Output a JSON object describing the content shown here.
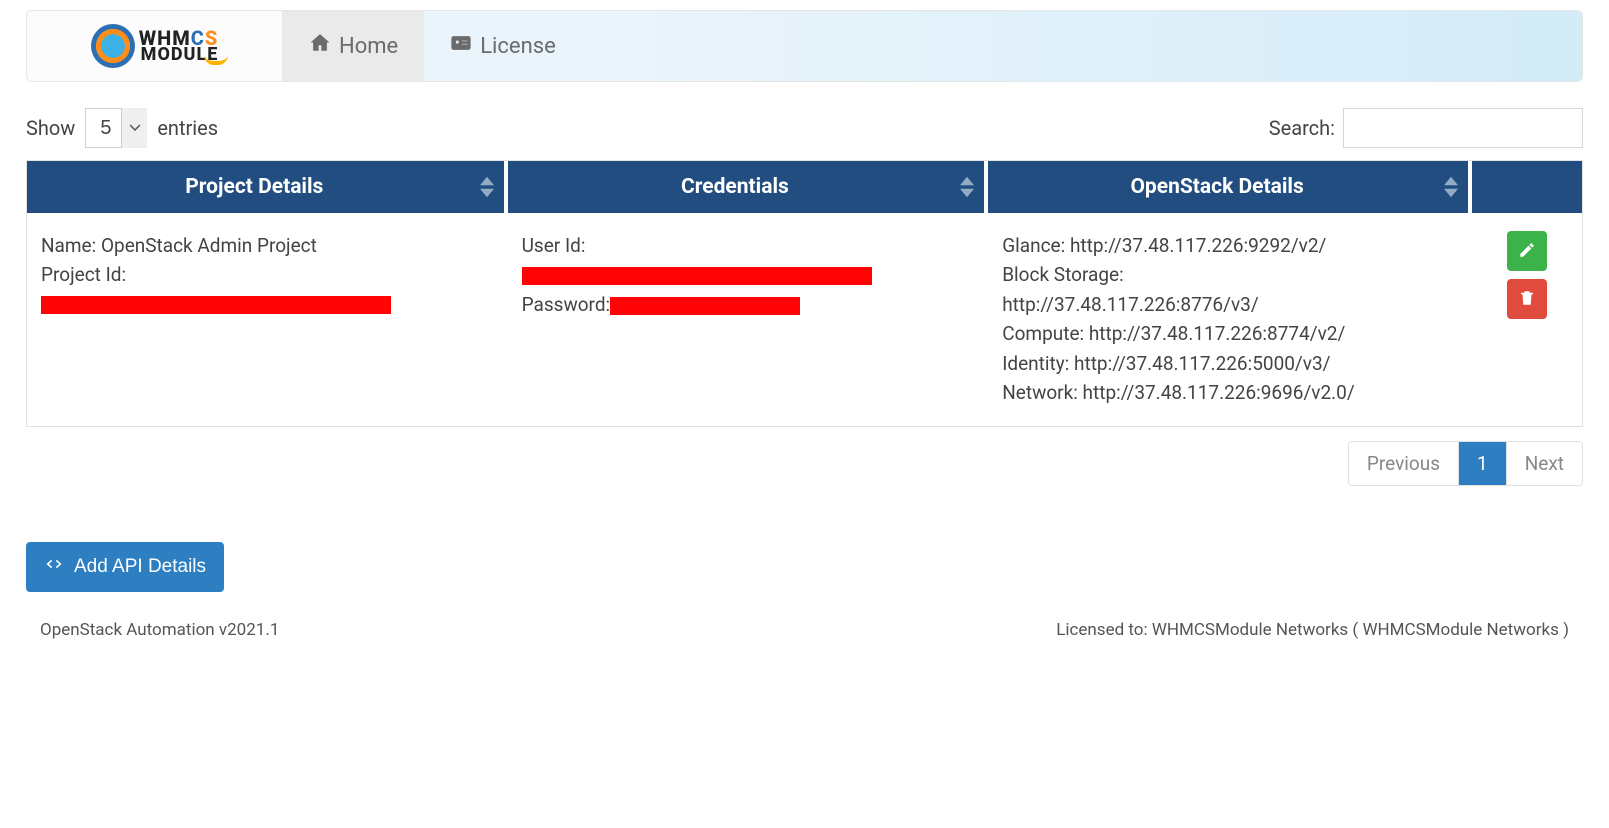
{
  "logo": {
    "brand1": "WHM",
    "brandC": "C",
    "brandS": "S",
    "brand2": "MODULE"
  },
  "nav": {
    "home": "Home",
    "license": "License"
  },
  "datatable": {
    "show_label_before": "Show",
    "show_label_after": "entries",
    "page_length": "5",
    "search_label": "Search:",
    "headers": {
      "project": "Project Details",
      "credentials": "Credentials",
      "openstack": "OpenStack Details"
    },
    "rows": [
      {
        "project": {
          "name_label": "Name:",
          "name_value": "OpenStack Admin Project",
          "id_label": "Project Id:"
        },
        "credentials": {
          "user_label": "User Id:",
          "password_label": "Password:"
        },
        "openstack": {
          "glance": "Glance: http://37.48.117.226:9292/v2/",
          "block_label": "Block Storage:",
          "block_url": "http://37.48.117.226:8776/v3/",
          "compute": "Compute: http://37.48.117.226:8774/v2/",
          "identity": "Identity: http://37.48.117.226:5000/v3/",
          "network": "Network: http://37.48.117.226:9696/v2.0/"
        }
      }
    ],
    "pagination": {
      "previous": "Previous",
      "page": "1",
      "next": "Next"
    }
  },
  "actions": {
    "add_api": "Add API Details"
  },
  "footer": {
    "version": "OpenStack Automation v2021.1",
    "license": "Licensed to: WHMCSModule Networks ( WHMCSModule Networks )"
  },
  "colors": {
    "header_bg": "#214d80",
    "primary_btn": "#2d7fc1",
    "edit_btn": "#3bb24a",
    "delete_btn": "#e04b3e",
    "redaction": "#ff0404"
  }
}
